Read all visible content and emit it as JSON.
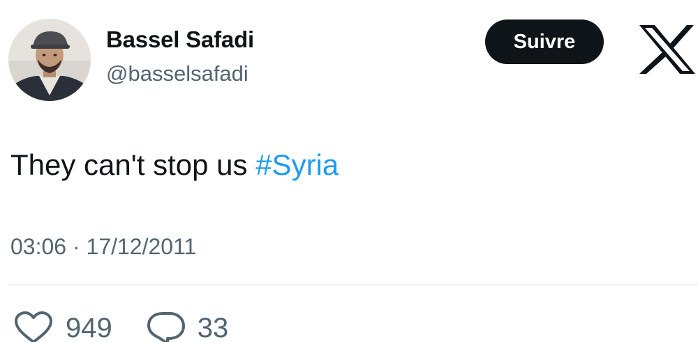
{
  "author": {
    "name": "Bassel Safadi",
    "handle": "@basselsafadi",
    "avatar_icon": "profile-photo"
  },
  "header": {
    "follow_label": "Suivre",
    "platform_icon": "x-logo-icon"
  },
  "tweet": {
    "text": "They can't stop us ",
    "hashtag": "#Syria",
    "timestamp": "03:06 · 17/12/2011"
  },
  "stats": {
    "likes": "949",
    "replies": "33",
    "like_icon": "heart-icon",
    "reply_icon": "comment-bubble-icon"
  },
  "colors": {
    "text": "#0f1419",
    "secondary": "#536471",
    "link": "#1d9bf0",
    "button_bg": "#0f1419",
    "divider": "#eff3f4"
  }
}
